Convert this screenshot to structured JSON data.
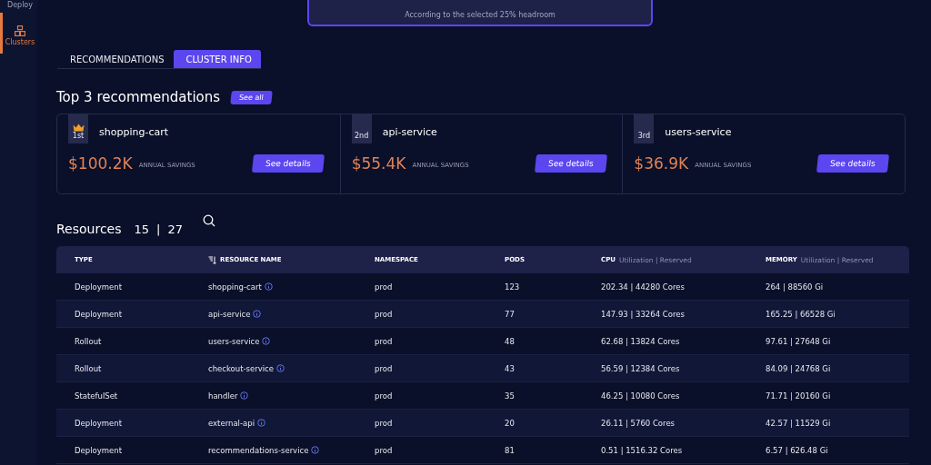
{
  "sidebar": {
    "items": [
      {
        "label": "Deploy",
        "selected": false,
        "icon": false
      },
      {
        "label": "Clusters",
        "selected": true,
        "icon": true
      }
    ]
  },
  "headroom_card": {
    "note": "According to the selected 25% headroom"
  },
  "tabs": [
    {
      "label": "RECOMMENDATIONS",
      "selected": false
    },
    {
      "label": "CLUSTER INFO",
      "selected": true
    }
  ],
  "top": {
    "title": "Top 3 recommendations",
    "see_all": "See all",
    "cards": [
      {
        "rank": "1st",
        "crown": true,
        "name": "shopping-cart",
        "amount": "$100.2K",
        "amount_label": "ANNUAL SAVINGS",
        "button": "See details"
      },
      {
        "rank": "2nd",
        "crown": false,
        "name": "api-service",
        "amount": "$55.4K",
        "amount_label": "ANNUAL SAVINGS",
        "button": "See details"
      },
      {
        "rank": "3rd",
        "crown": false,
        "name": "users-service",
        "amount": "$36.9K",
        "amount_label": "ANNUAL SAVINGS",
        "button": "See details"
      }
    ]
  },
  "resources": {
    "title": "Resources",
    "shown": "15",
    "separator": "|",
    "total": "27",
    "columns": [
      {
        "label": "TYPE",
        "sort": false
      },
      {
        "label": "RESOURCE NAME",
        "sort": true
      },
      {
        "label": "NAMESPACE",
        "sort": false
      },
      {
        "label": "PODS",
        "sort": false
      },
      {
        "label": "CPU",
        "sub": "Utilization | Reserved",
        "sort": false
      },
      {
        "label": "MEMORY",
        "sub": "Utilization | Reserved",
        "sort": false
      }
    ],
    "rows": [
      [
        "Deployment",
        "shopping-cart",
        "prod",
        "123",
        "202.34 | 44280 Cores",
        "264 | 88560 Gi"
      ],
      [
        "Deployment",
        "api-service",
        "prod",
        "77",
        "147.93 | 33264 Cores",
        "165.25 | 66528 Gi"
      ],
      [
        "Rollout",
        "users-service",
        "prod",
        "48",
        "62.68 | 13824 Cores",
        "97.61 | 27648 Gi"
      ],
      [
        "Rollout",
        "checkout-service",
        "prod",
        "43",
        "56.59 | 12384 Cores",
        "84.09 | 24768 Gi"
      ],
      [
        "StatefulSet",
        "handler",
        "prod",
        "35",
        "46.25 | 10080 Cores",
        "71.71 | 20160 Gi"
      ],
      [
        "Deployment",
        "external-api",
        "prod",
        "20",
        "26.11 | 5760 Cores",
        "42.57 | 11529 Gi"
      ],
      [
        "Deployment",
        "recommendations-service",
        "prod",
        "81",
        "0.51 | 1516.32 Cores",
        "6.57 | 626.48 Gi"
      ]
    ]
  }
}
